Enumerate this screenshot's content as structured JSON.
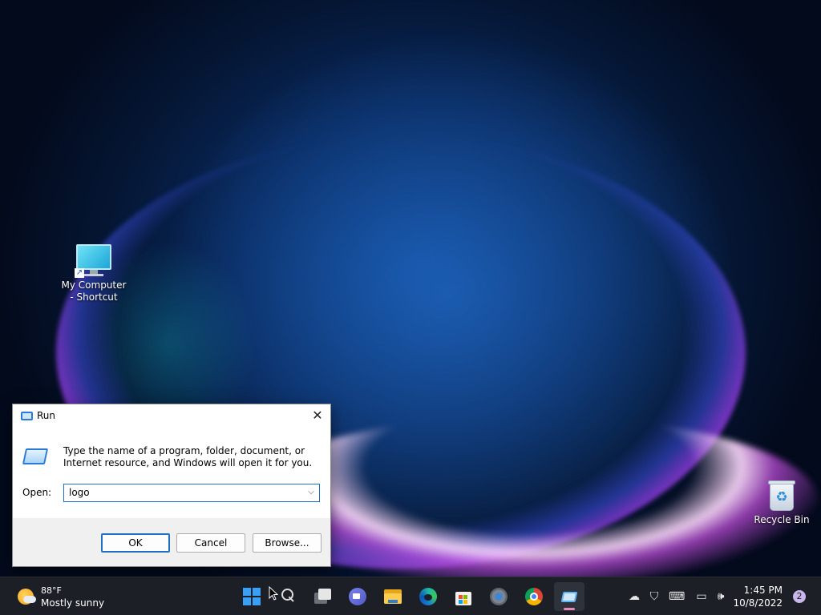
{
  "desktop": {
    "icons": [
      {
        "label_line1": "My Computer",
        "label_line2": "- Shortcut",
        "icon": "computer-monitor-icon"
      },
      {
        "label": "Recycle Bin",
        "icon": "recycle-bin-icon"
      }
    ]
  },
  "run_dialog": {
    "title": "Run",
    "close_glyph": "✕",
    "description": "Type the name of a program, folder, document, or Internet resource, and Windows will open it for you.",
    "open_label": "Open:",
    "open_value": "logo",
    "ok_label": "OK",
    "cancel_label": "Cancel",
    "browse_label": "Browse..."
  },
  "taskbar": {
    "weather": {
      "temp": "88°F",
      "condition": "Mostly sunny",
      "icon": "partly-sunny-icon"
    },
    "apps": [
      {
        "name": "Start",
        "icon": "windows-start-icon"
      },
      {
        "name": "Search",
        "icon": "search-icon"
      },
      {
        "name": "Task View",
        "icon": "task-view-icon"
      },
      {
        "name": "Chat",
        "icon": "teams-chat-icon"
      },
      {
        "name": "File Explorer",
        "icon": "folder-icon"
      },
      {
        "name": "Microsoft Edge",
        "icon": "edge-icon"
      },
      {
        "name": "Microsoft Store",
        "icon": "store-icon"
      },
      {
        "name": "Settings",
        "icon": "gear-icon"
      },
      {
        "name": "Google Chrome",
        "icon": "chrome-icon"
      },
      {
        "name": "Run",
        "icon": "run-icon"
      }
    ],
    "tray": {
      "time": "1:45 PM",
      "date": "10/8/2022",
      "notifications": "2"
    }
  },
  "colors": {
    "accent": "#1f6fc5",
    "taskbar_bg": "#1c1f26",
    "active_indicator": "#e989b8"
  }
}
